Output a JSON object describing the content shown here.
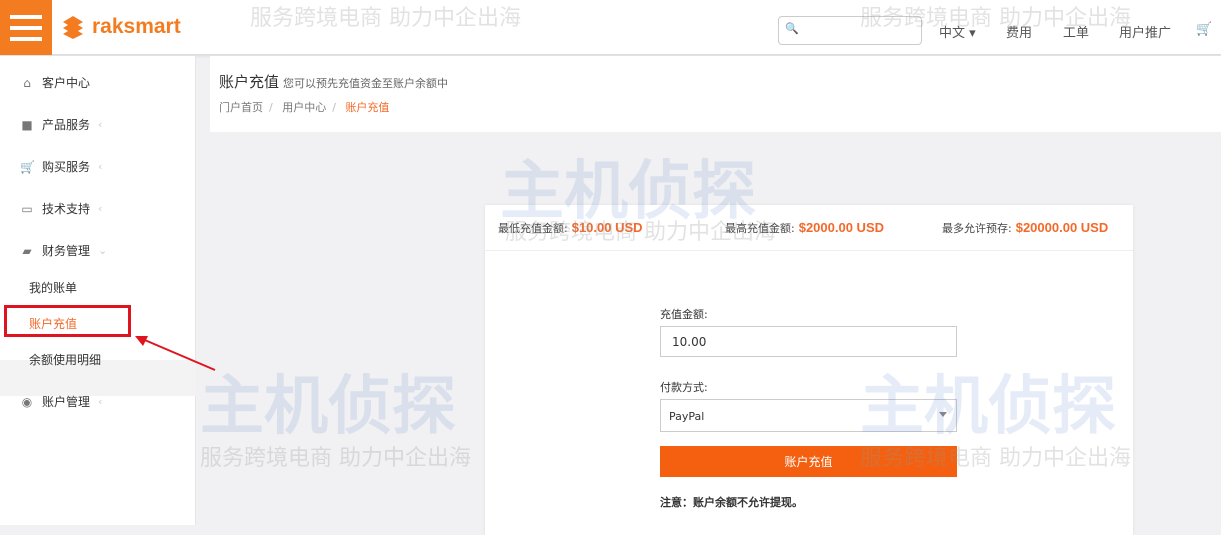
{
  "header": {
    "logo": "raksmart",
    "search_placeholder": "",
    "nav": [
      "中文",
      "费用",
      "工单",
      "用户推广"
    ]
  },
  "sidebar": {
    "items": [
      {
        "label": "客户中心"
      },
      {
        "label": "产品服务"
      },
      {
        "label": "购买服务"
      },
      {
        "label": "技术支持"
      },
      {
        "label": "财务管理"
      }
    ],
    "sub": [
      "我的账单",
      "账户充值",
      "余额使用明细"
    ],
    "account": "账户管理"
  },
  "page": {
    "title": "账户充值",
    "subtitle": "您可以预先充值资金至账户余额中",
    "breadcrumb": [
      "门户首页",
      "用户中心",
      "账户充值"
    ]
  },
  "limits": {
    "min_label": "最低充值金额:",
    "min": "$10.00 USD",
    "max_label": "最高充值金额:",
    "max": "$2000.00 USD",
    "deposit_label": "最多允许预存:",
    "deposit": "$20000.00 USD"
  },
  "form": {
    "amount_label": "充值金额:",
    "amount": "10.00",
    "method_label": "付款方式:",
    "method": "PayPal",
    "submit": "账户充值",
    "note": "注意：账户余额不允许提现。"
  },
  "watermark": {
    "brand": "主机侦探",
    "slogan": "服务跨境电商 助力中企出海"
  },
  "colors": {
    "accent": "#f47c20",
    "highlight": "#e0141e"
  }
}
